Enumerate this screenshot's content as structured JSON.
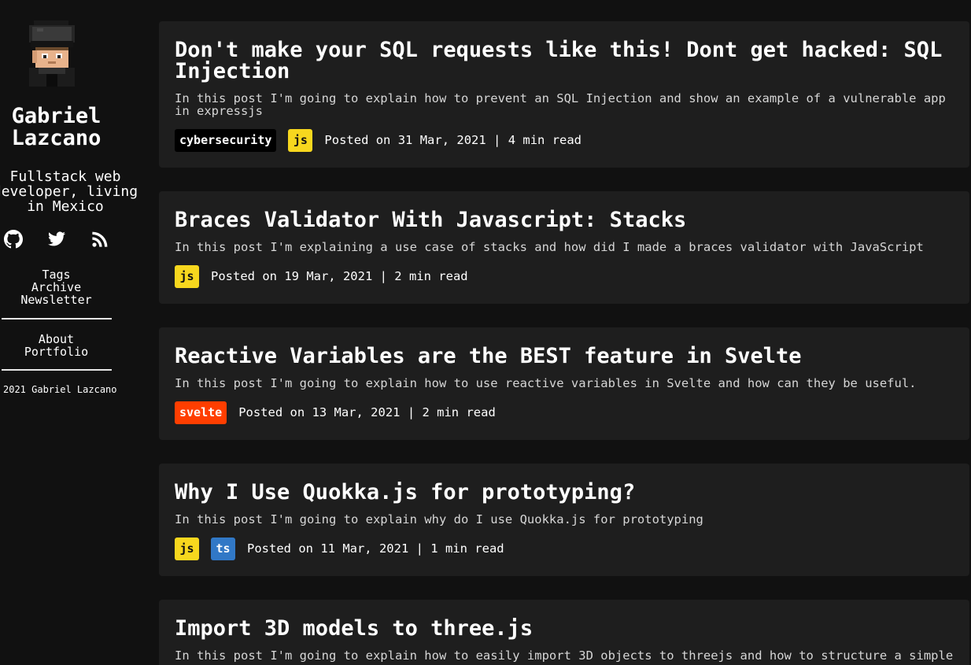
{
  "sidebar": {
    "name": "Gabriel Lazcano",
    "bio": "Fullstack web developer, living in Mexico",
    "nav_primary": [
      "Tags",
      "Archive",
      "Newsletter"
    ],
    "nav_secondary": [
      "About",
      "Portfolio"
    ],
    "footer": "2021 Gabriel Lazcano",
    "social_icons": [
      "github-icon",
      "twitter-icon",
      "rss-icon"
    ]
  },
  "posts": [
    {
      "title": "Don't make your SQL requests like this! Dont get hacked: SQL Injection",
      "description": "In this post I'm going to explain how to prevent an SQL Injection and show an example of a vulnerable app in expressjs",
      "tags": [
        "cybersecurity",
        "js"
      ],
      "meta": "Posted on 31 Mar, 2021  |  4 min read"
    },
    {
      "title": "Braces Validator With Javascript: Stacks",
      "description": "In this post I'm explaining a use case of stacks and how did I made a braces validator with JavaScript",
      "tags": [
        "js"
      ],
      "meta": "Posted on 19 Mar, 2021  |  2 min read"
    },
    {
      "title": "Reactive Variables are the BEST feature in Svelte",
      "description": "In this post I'm going to explain how to use reactive variables in Svelte and how can they be useful.",
      "tags": [
        "svelte"
      ],
      "meta": "Posted on 13 Mar, 2021  |  2 min read"
    },
    {
      "title": "Why I Use Quokka.js for prototyping?",
      "description": "In this post I'm going to explain why do I use Quokka.js for prototyping",
      "tags": [
        "js",
        "ts"
      ],
      "meta": "Posted on 11 Mar, 2021  |  1 min read"
    },
    {
      "title": "Import 3D models to three.js",
      "description": "In this post I'm going to explain how to easily import 3D objects to threejs and how to structure a simple",
      "tags": [],
      "meta": ""
    }
  ],
  "colors": {
    "background": "#111111",
    "card": "#1e1e1e",
    "tag_js": "#f7d71e",
    "tag_svelte": "#ff3e00",
    "tag_ts": "#3178c6",
    "tag_cybersecurity": "#000000"
  }
}
